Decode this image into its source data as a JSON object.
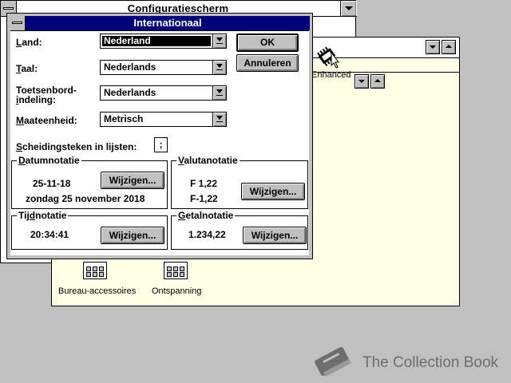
{
  "control_panel": {
    "title": "Configuratiescherm"
  },
  "program_manager": {
    "enhanced_label": "Enhanced",
    "groups": [
      {
        "label": "Bureau-accessoires"
      },
      {
        "label": "Ontspanning"
      }
    ]
  },
  "dialog": {
    "title": "Internationaal",
    "land": {
      "label_first": "L",
      "label_rest": "and:",
      "value": "Nederland"
    },
    "taal": {
      "label_first": "T",
      "label_rest": "aal:",
      "value": "Nederlands"
    },
    "toetsenbord": {
      "label_line1": "Toetsenbord-",
      "label_first": "i",
      "label_rest": "ndeling:",
      "value": "Nederlands"
    },
    "maateenheid": {
      "label_first": "M",
      "label_rest": "aateenheid:",
      "value": "Metrisch"
    },
    "scheidingsteken": {
      "label_first": "S",
      "label_rest": "cheidingsteken in lijsten:",
      "value": ";"
    },
    "ok_label": "OK",
    "cancel_label": "Annuleren",
    "datum": {
      "title_first": "D",
      "title_rest": "atumnotatie",
      "short": "25-11-18",
      "long": "zondag  25  november  2018",
      "button": "Wijzigen..."
    },
    "valuta": {
      "title_first": "V",
      "title_rest": "alutanotatie",
      "positive": "F 1,22",
      "negative": "F-1,22",
      "button": "Wijzigen..."
    },
    "tijd": {
      "title_pre": "Tij",
      "title_first": "d",
      "title_rest": "notatie",
      "value": "20:34:41",
      "button": "Wijzigen..."
    },
    "getal": {
      "title_first": "G",
      "title_rest": "etalnotatie",
      "value": "1.234,22",
      "button": "Wijzigen..."
    }
  },
  "watermark": {
    "text": "The Collection Book"
  },
  "colors": {
    "desktop": "#c0c0c0",
    "titlebar_active": "#00007b",
    "group_bg": "#ffffe6"
  },
  "icons": [
    "system-menu-icon",
    "minimize-arrow-icon",
    "enhanced-chip-icon",
    "program-group-icon",
    "book-icon",
    "dropdown-arrow-icon"
  ]
}
